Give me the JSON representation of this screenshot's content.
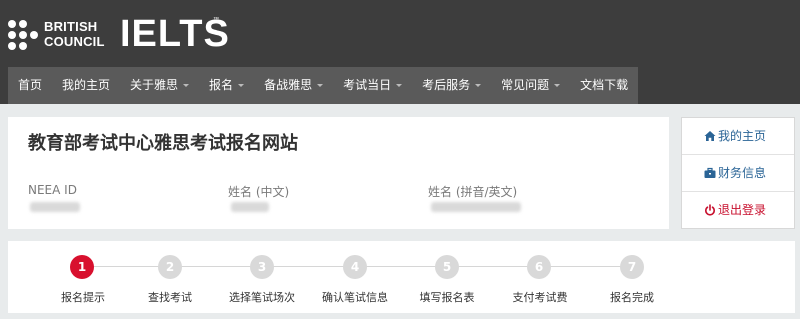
{
  "header": {
    "brand_line1": "BRITISH",
    "brand_line2": "COUNCIL",
    "product": "IELTS",
    "trademark": "™"
  },
  "nav": {
    "items": [
      {
        "label": "首页",
        "dropdown": false
      },
      {
        "label": "我的主页",
        "dropdown": false
      },
      {
        "label": "关于雅思",
        "dropdown": true
      },
      {
        "label": "报名",
        "dropdown": true
      },
      {
        "label": "备战雅思",
        "dropdown": true
      },
      {
        "label": "考试当日",
        "dropdown": true
      },
      {
        "label": "考后服务",
        "dropdown": true
      },
      {
        "label": "常见问题",
        "dropdown": true
      },
      {
        "label": "文档下载",
        "dropdown": false
      }
    ]
  },
  "info": {
    "title": "教育部考试中心雅思考试报名网站",
    "fields": [
      {
        "label": "NEEA ID",
        "value": ""
      },
      {
        "label": "姓名 (中文)",
        "value": ""
      },
      {
        "label": "姓名 (拼音/英文)",
        "value": ""
      }
    ]
  },
  "side": {
    "items": [
      {
        "label": "我的主页",
        "icon": "home-icon",
        "color": "#2a6496"
      },
      {
        "label": "财务信息",
        "icon": "briefcase-icon",
        "color": "#2a6496"
      },
      {
        "label": "退出登录",
        "icon": "power-icon",
        "color": "#c8102e"
      }
    ]
  },
  "steps": {
    "active_index": 0,
    "active_color": "#d8102e",
    "inactive_color": "#d9d9d9",
    "items": [
      {
        "number": "1",
        "label": "报名提示"
      },
      {
        "number": "2",
        "label": "查找考试"
      },
      {
        "number": "3",
        "label": "选择笔试场次"
      },
      {
        "number": "4",
        "label": "确认笔试信息"
      },
      {
        "number": "5",
        "label": "填写报名表"
      },
      {
        "number": "6",
        "label": "支付考试费"
      },
      {
        "number": "7",
        "label": "报名完成"
      }
    ]
  }
}
